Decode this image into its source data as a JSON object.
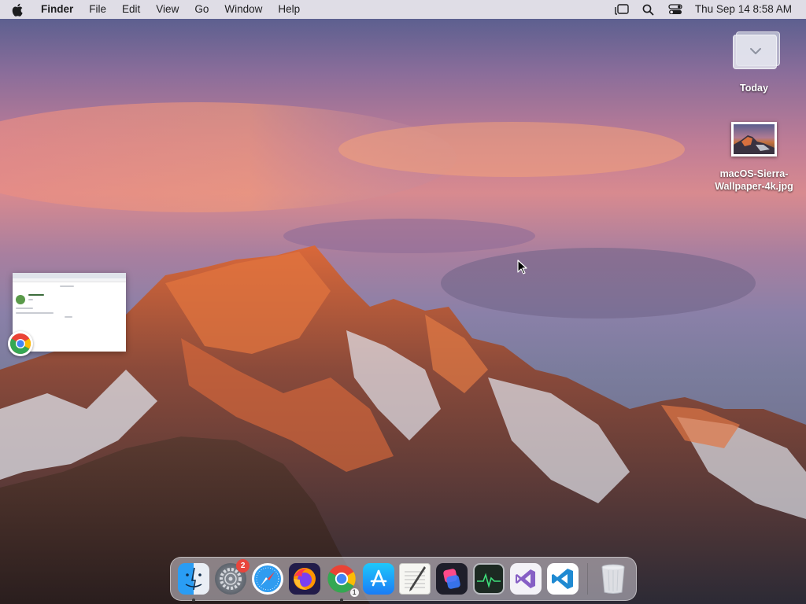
{
  "menubar": {
    "apple_icon": "apple-logo-icon",
    "app_name": "Finder",
    "menus": [
      "File",
      "Edit",
      "View",
      "Go",
      "Window",
      "Help"
    ],
    "status_icons": [
      "stage-manager-icon",
      "spotlight-search-icon",
      "control-center-icon"
    ],
    "clock": "Thu Sep 14  8:58 AM"
  },
  "desktop": {
    "items": [
      {
        "label": "Today",
        "icon": "stack-folder-icon"
      },
      {
        "label_line1": "macOS-Sierra-",
        "label_line2": "Wallpaper-4k.jpg",
        "icon": "image-file-icon"
      }
    ],
    "window_preview": {
      "app": "Google Chrome",
      "icon": "chrome-icon"
    }
  },
  "dock": {
    "items": [
      {
        "name": "Finder",
        "icon": "finder-icon",
        "running": true
      },
      {
        "name": "System Settings",
        "icon": "system-settings-icon",
        "badge": "2"
      },
      {
        "name": "Safari",
        "icon": "safari-icon"
      },
      {
        "name": "Firefox",
        "icon": "firefox-icon"
      },
      {
        "name": "Google Chrome",
        "icon": "chrome-icon",
        "running": true,
        "sub_badge": "1"
      },
      {
        "name": "App Store",
        "icon": "app-store-icon"
      },
      {
        "name": "TextEdit",
        "icon": "textedit-icon"
      },
      {
        "name": "Shortcuts",
        "icon": "shortcuts-icon"
      },
      {
        "name": "Activity Monitor",
        "icon": "activity-monitor-icon"
      },
      {
        "name": "Visual Studio",
        "icon": "visual-studio-icon"
      },
      {
        "name": "Visual Studio Code",
        "icon": "vscode-icon"
      },
      {
        "name": "Trash",
        "icon": "trash-icon"
      }
    ]
  },
  "colors": {
    "menubar_bg": "#ece8ee",
    "badge_red": "#e8453c",
    "chrome_red": "#ea4335",
    "chrome_yellow": "#fbbc05",
    "chrome_green": "#34a853",
    "chrome_blue": "#4285f4"
  }
}
